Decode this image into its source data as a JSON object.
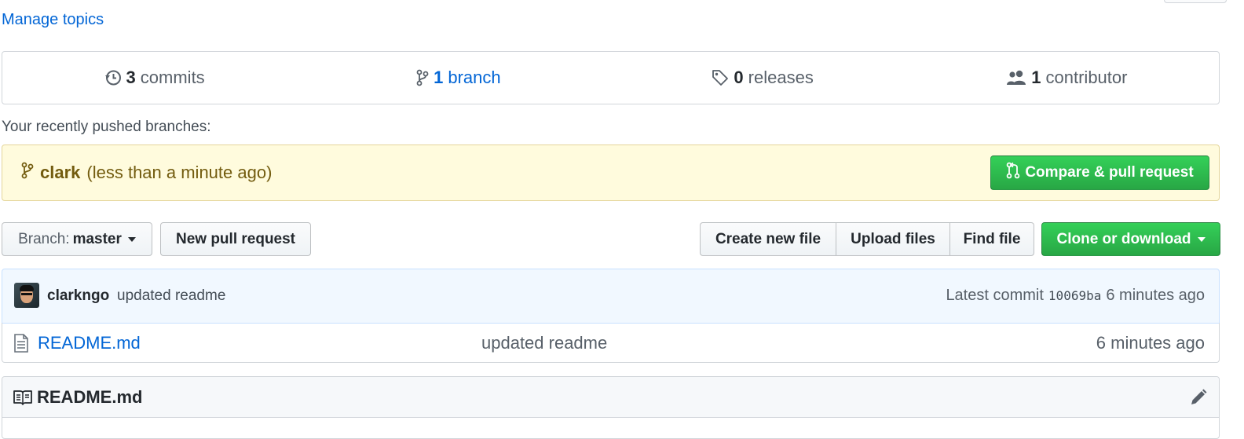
{
  "topics": {
    "manage_label": "Manage topics"
  },
  "numbers_summary": {
    "commits": {
      "count": "3",
      "label": "commits"
    },
    "branches": {
      "count": "1",
      "label": "branch"
    },
    "releases": {
      "count": "0",
      "label": "releases"
    },
    "contributors": {
      "count": "1",
      "label": "contributor"
    }
  },
  "recent_branches": {
    "heading": "Your recently pushed branches:",
    "branch_name": "clark",
    "pushed_time": "(less than a minute ago)",
    "compare_label": "Compare & pull request"
  },
  "toolbar": {
    "branch_prefix": "Branch:",
    "branch_name": "master",
    "new_pr_label": "New pull request",
    "create_file_label": "Create new file",
    "upload_label": "Upload files",
    "find_label": "Find file",
    "clone_label": "Clone or download"
  },
  "latest_commit": {
    "author": "clarkngo",
    "message": "updated readme",
    "prefix": "Latest commit",
    "sha": "10069ba",
    "age": "6 minutes ago"
  },
  "files": [
    {
      "name": "README.md",
      "message": "updated readme",
      "age": "6 minutes ago"
    }
  ],
  "readme": {
    "title": "README.md"
  },
  "colors": {
    "link": "#0366d6",
    "green_button": "#28a745",
    "flash_background": "#fffbdd",
    "commit_background": "#f1f8ff"
  },
  "icons": [
    "history-icon",
    "branch-icon",
    "tag-icon",
    "people-icon",
    "pull-request-icon",
    "file-icon",
    "book-icon",
    "pencil-icon"
  ]
}
